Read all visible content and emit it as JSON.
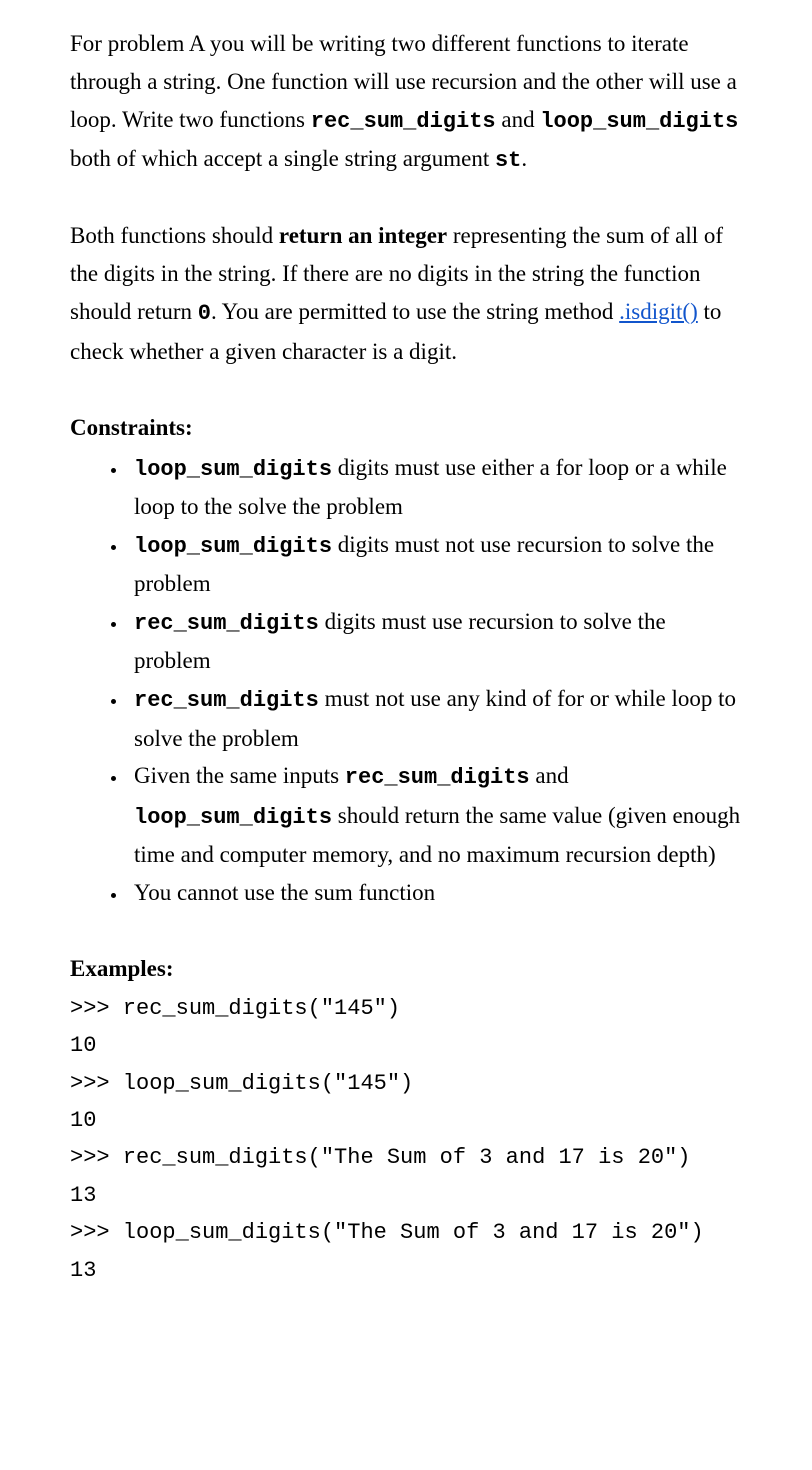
{
  "para1": {
    "t1": "For problem A you will be writing two different functions to iterate through a string. One function will use recursion and the other will use a loop. Write two functions ",
    "c1": "rec_sum_digits",
    "t2": " and ",
    "c2": "loop_sum_digits",
    "t3": " both of which accept a single string argument ",
    "c3": "st",
    "t4": "."
  },
  "para2": {
    "t1": "Both functions should  ",
    "b1": "return an integer",
    "t2": " representing the sum of all of the digits in the string.  If there are no digits in the string the function should return ",
    "c1": "0",
    "t3": ".  You are permitted to use the string method ",
    "link": ".isdigit()",
    "t4": " to check whether a given character is a digit."
  },
  "constraints_label": "Constraints",
  "constraints": [
    {
      "c1": "loop_sum_digits",
      "t1": "  digits must use either a for loop or a while loop to the solve the problem"
    },
    {
      "c1": "loop_sum_digits",
      "t1": "  digits must not use recursion to solve the problem"
    },
    {
      "c1": "rec_sum_digits",
      "t1": "  digits must use recursion to solve the problem"
    },
    {
      "c1": "rec_sum_digits",
      "t1": "  must not use any kind of for or while loop to solve the problem"
    }
  ],
  "constraint5": {
    "t1": "Given the same inputs  ",
    "c1": "rec_sum_digits",
    "t2": " and ",
    "c2": "loop_sum_digits",
    "t3": " should return the same value (given enough time and computer memory, and no maximum recursion depth)"
  },
  "constraint6": "You cannot use the sum function",
  "examples_label": "Examples",
  "examples": ">>> rec_sum_digits(\"145\")\n10\n>>> loop_sum_digits(\"145\")\n10\n>>> rec_sum_digits(\"The Sum of 3 and 17 is 20\")\n13\n>>> loop_sum_digits(\"The Sum of 3 and 17 is 20\")\n13"
}
